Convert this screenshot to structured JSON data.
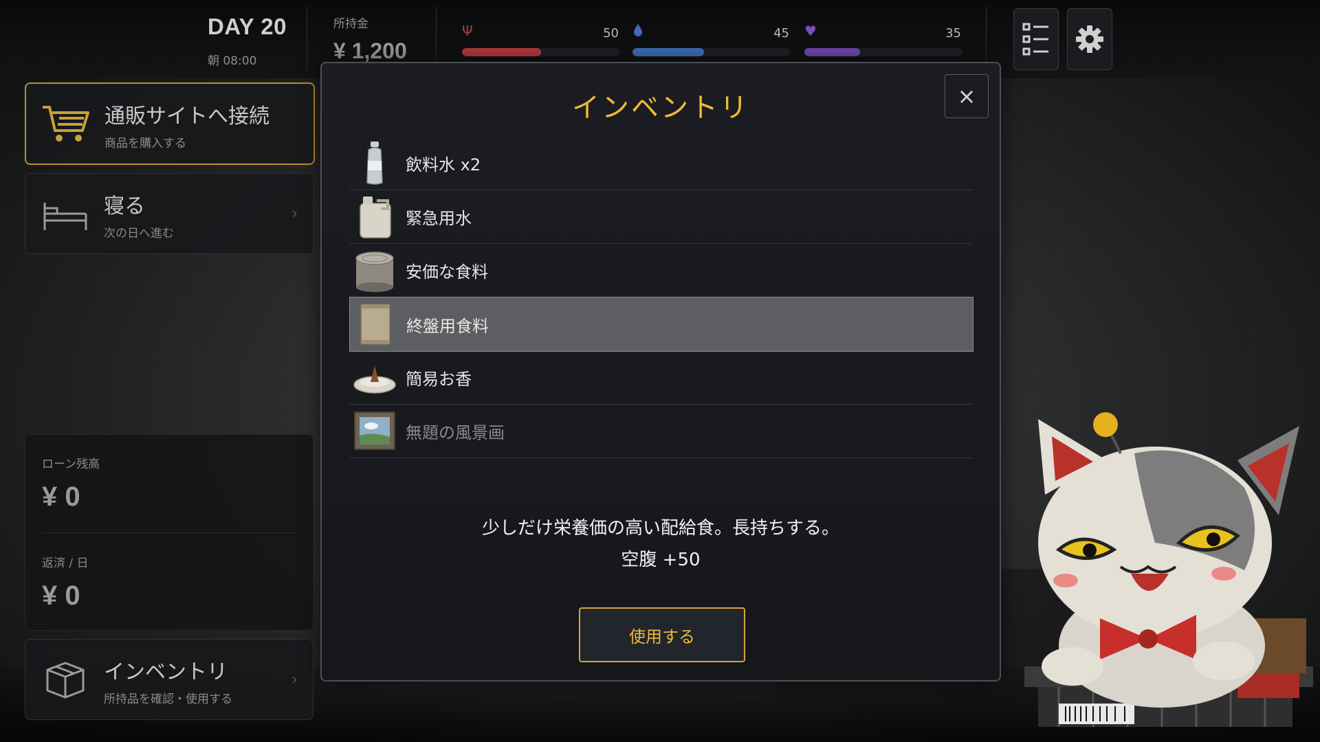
{
  "hud": {
    "day": "DAY 20",
    "time": "朝 08:00",
    "money_label": "所持金",
    "money_value": "¥ 1,200",
    "stats": [
      {
        "name": "hunger",
        "icon": "fork-icon",
        "value": "50",
        "fraction": 0.5,
        "color": "#b0393a"
      },
      {
        "name": "thirst",
        "icon": "water-drop-icon",
        "value": "45",
        "fraction": 0.45,
        "color": "#3c6db5"
      },
      {
        "name": "mental",
        "icon": "heart-icon",
        "value": "35",
        "fraction": 0.35,
        "color": "#6e45a8"
      }
    ]
  },
  "menu": {
    "shop": {
      "title": "通販サイトへ接続",
      "sub": "商品を購入する"
    },
    "sleep": {
      "title": "寝る",
      "sub": "次の日へ進む"
    },
    "inventory": {
      "title": "インベントリ",
      "sub": "所持品を確認・使用する"
    }
  },
  "loan": {
    "balance_label": "ローン残高",
    "balance_value": "¥ 0",
    "daily_label": "返済 / 日",
    "daily_value": "¥ 0"
  },
  "modal": {
    "title": "インベントリ",
    "items": [
      {
        "name": "飲料水 x2",
        "icon": "water-bottle-icon"
      },
      {
        "name": "緊急用水",
        "icon": "water-jug-icon"
      },
      {
        "name": "安価な食料",
        "icon": "tin-can-icon"
      },
      {
        "name": "終盤用食料",
        "icon": "ration-pack-icon",
        "selected": true
      },
      {
        "name": "簡易お香",
        "icon": "incense-icon"
      },
      {
        "name": "無題の風景画",
        "icon": "landscape-painting-icon",
        "dim": true
      }
    ],
    "description": "少しだけ栄養価の高い配給食。長持ちする。",
    "effect": "空腹 +50",
    "use_label": "使用する"
  },
  "colors": {
    "accent": "#f0b938",
    "gold_border": "#b7922f"
  }
}
